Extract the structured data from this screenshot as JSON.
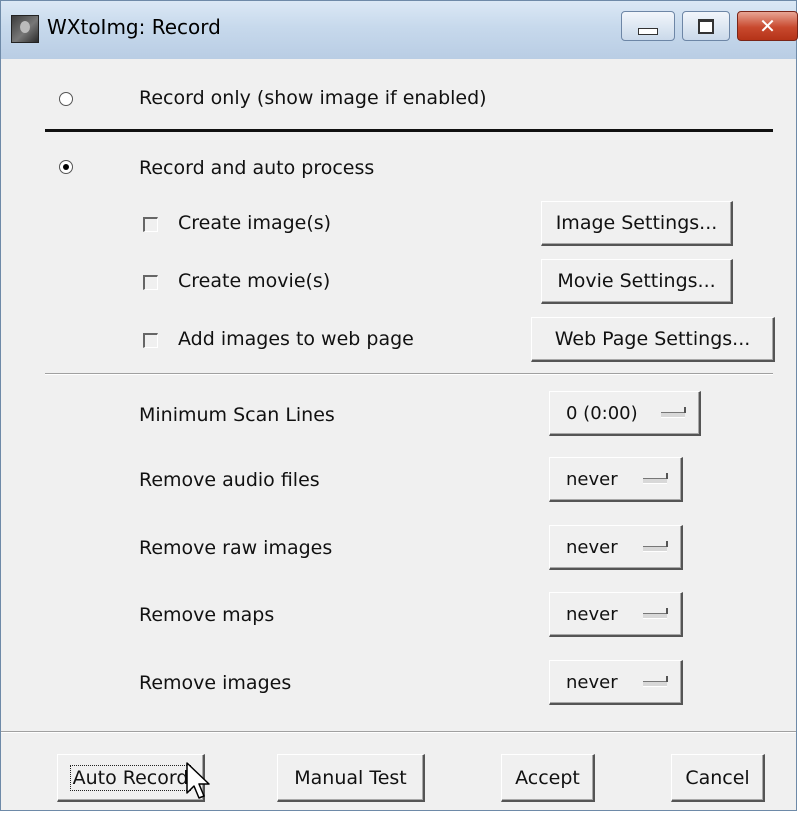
{
  "window": {
    "title": "WXtoImg: Record",
    "icons": {
      "app": "wxtoimg-app-icon",
      "minimize": "minimize-icon",
      "maximize": "maximize-icon",
      "close": "close-icon"
    }
  },
  "mode": {
    "record_only_label": "Record only (show image if enabled)",
    "record_only_selected": false,
    "auto_process_label": "Record and auto process",
    "auto_process_selected": true
  },
  "processing": {
    "create_images_label": "Create image(s)",
    "create_images_checked": false,
    "image_settings_button": "Image Settings...",
    "create_movies_label": "Create movie(s)",
    "create_movies_checked": false,
    "movie_settings_button": "Movie Settings...",
    "web_page_label": "Add images to web page",
    "web_page_checked": false,
    "web_page_settings_button": "Web Page Settings..."
  },
  "options": {
    "min_scan_lines_label": "Minimum Scan Lines",
    "min_scan_lines_value": "0 (0:00)",
    "remove_audio_label": "Remove audio files",
    "remove_audio_value": "never",
    "remove_raw_label": "Remove raw images",
    "remove_raw_value": "never",
    "remove_maps_label": "Remove maps",
    "remove_maps_value": "never",
    "remove_images_label": "Remove images",
    "remove_images_value": "never"
  },
  "buttons": {
    "auto_record": "Auto Record",
    "manual_test": "Manual Test",
    "accept": "Accept",
    "cancel": "Cancel"
  }
}
